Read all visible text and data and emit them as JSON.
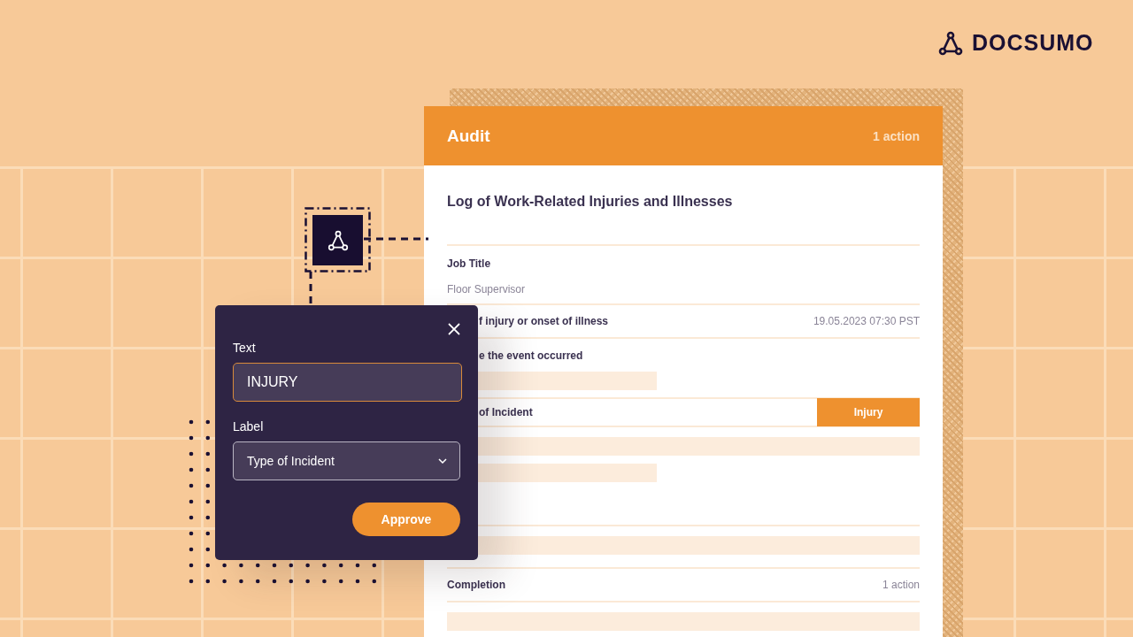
{
  "logo": {
    "text": "DOCSUMO"
  },
  "card": {
    "title": "Audit",
    "actions": "1 action",
    "document_title": "Log of Work-Related Injuries and Illnesses",
    "sections": [
      {
        "kind": "field",
        "label": "Job Title",
        "value": "Floor Supervisor"
      },
      {
        "kind": "inline",
        "label": "f injury or onset of illness",
        "value": "19.05.2023 07:30 PST",
        "covered": true
      },
      {
        "kind": "placeholder",
        "label": "e the event occurred",
        "covered": true,
        "bars": [
          {
            "kind": "short"
          }
        ]
      },
      {
        "kind": "tag",
        "label": "of Incident",
        "tag": "Injury",
        "covered": true
      },
      {
        "kind": "bars",
        "bars": [
          {
            "kind": "full"
          },
          {
            "kind": "short"
          }
        ]
      },
      {
        "kind": "bars",
        "bars": [
          {
            "kind": "full"
          }
        ]
      },
      {
        "kind": "inline",
        "label": "Completion",
        "value": "1 action"
      },
      {
        "kind": "bars",
        "bars": [
          {
            "kind": "full"
          }
        ]
      }
    ]
  },
  "popup": {
    "text_label": "Text",
    "text_value": "INJURY",
    "label_label": "Label",
    "label_value": "Type of Incident",
    "button": "Approve"
  }
}
